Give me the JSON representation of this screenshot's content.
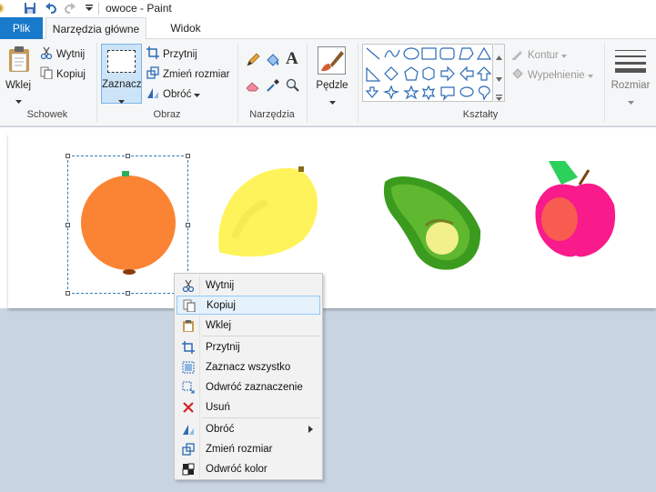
{
  "window": {
    "title": "owoce - Paint"
  },
  "tabs": {
    "file": "Plik",
    "home": "Narzędzia główne",
    "view": "Widok"
  },
  "clipboard": {
    "paste": "Wklej",
    "cut": "Wytnij",
    "copy": "Kopiuj",
    "group": "Schowek"
  },
  "image": {
    "select": "Zaznacz",
    "crop": "Przytnij",
    "resize": "Zmień rozmiar",
    "rotate": "Obróć",
    "group": "Obraz"
  },
  "tools": {
    "group": "Narzędzia",
    "text_tool": "A"
  },
  "brushes": {
    "label": "Pędzle"
  },
  "shapes": {
    "group": "Kształty",
    "outline": "Kontur",
    "fill": "Wypełnienie"
  },
  "size": {
    "label": "Rozmiar"
  },
  "context_menu": {
    "items": [
      {
        "label": "Wytnij",
        "icon": "scissors-icon"
      },
      {
        "label": "Kopiuj",
        "icon": "copy-icon",
        "highlighted": true
      },
      {
        "label": "Wklej",
        "icon": "paste-icon"
      },
      {
        "label": "Przytnij",
        "icon": "crop-icon"
      },
      {
        "label": "Zaznacz wszystko",
        "icon": "select-all-icon"
      },
      {
        "label": "Odwróć zaznaczenie",
        "icon": "invert-selection-icon"
      },
      {
        "label": "Usuń",
        "icon": "delete-icon"
      },
      {
        "label": "Obróć",
        "icon": "rotate-icon",
        "submenu": true
      },
      {
        "label": "Zmień rozmiar",
        "icon": "resize-icon"
      },
      {
        "label": "Odwróć kolor",
        "icon": "invert-color-icon"
      }
    ]
  },
  "colors": {
    "accent": "#1979ca",
    "selection": "#2c7fb8",
    "canvas_bg": "#c9d4e3"
  }
}
